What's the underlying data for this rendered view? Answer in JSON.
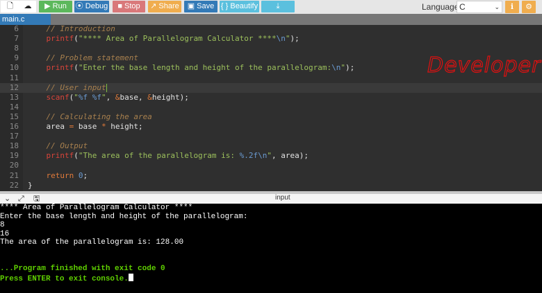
{
  "toolbar": {
    "new_file_icon": "file-icon",
    "upload_icon": "cloud-upload-icon",
    "run": {
      "icon": "▶",
      "label": "Run",
      "color": "#5cb85c"
    },
    "debug": {
      "icon": "⦿",
      "label": "Debug",
      "color": "#337ab7"
    },
    "stop": {
      "icon": "■",
      "label": "Stop",
      "color": "#d9787a"
    },
    "share": {
      "icon": "↗",
      "label": "Share",
      "color": "#f0ad4e"
    },
    "save": {
      "icon": "💾",
      "label": "Save",
      "color": "#337ab7"
    },
    "beautify": {
      "label": "{ } Beautify",
      "color": "#5bc0de"
    },
    "download": {
      "icon": "⤓",
      "color": "#5bc0de"
    },
    "language_label": "Language",
    "language_value": "C",
    "info_icon": "info-icon",
    "settings_icon": "gear-icon"
  },
  "tabs": [
    {
      "label": "main.c",
      "active": true
    }
  ],
  "watermark": "Developer",
  "editor": {
    "lines": [
      {
        "n": "6",
        "tokens": [
          [
            "c",
            "    // Introduction"
          ]
        ]
      },
      {
        "n": "7",
        "tokens": [
          [
            "p",
            "    "
          ],
          [
            "fn",
            "printf"
          ],
          [
            "p",
            "("
          ],
          [
            "s",
            "\"**** Area of Parallelogram Calculator ****"
          ],
          [
            "e",
            "\\n"
          ],
          [
            "s",
            "\""
          ],
          [
            "p",
            ");"
          ]
        ]
      },
      {
        "n": "8",
        "tokens": []
      },
      {
        "n": "9",
        "tokens": [
          [
            "c",
            "    // Problem statement"
          ]
        ]
      },
      {
        "n": "10",
        "tokens": [
          [
            "p",
            "    "
          ],
          [
            "fn",
            "printf"
          ],
          [
            "p",
            "("
          ],
          [
            "s",
            "\"Enter the base length and height of the parallelogram:"
          ],
          [
            "e",
            "\\n"
          ],
          [
            "s",
            "\""
          ],
          [
            "p",
            ");"
          ]
        ]
      },
      {
        "n": "11",
        "tokens": []
      },
      {
        "n": "12",
        "tokens": [
          [
            "c",
            "    // User input"
          ]
        ],
        "active": true
      },
      {
        "n": "13",
        "tokens": [
          [
            "p",
            "    "
          ],
          [
            "fn",
            "scanf"
          ],
          [
            "p",
            "("
          ],
          [
            "s",
            "\""
          ],
          [
            "e",
            "%f %f"
          ],
          [
            "s",
            "\""
          ],
          [
            "p",
            ", "
          ],
          [
            "op",
            "&"
          ],
          [
            "v",
            "base"
          ],
          [
            "p",
            ", "
          ],
          [
            "op",
            "&"
          ],
          [
            "v",
            "height"
          ],
          [
            "p",
            ");"
          ]
        ]
      },
      {
        "n": "14",
        "tokens": []
      },
      {
        "n": "15",
        "tokens": [
          [
            "c",
            "    // Calculating the area"
          ]
        ]
      },
      {
        "n": "16",
        "tokens": [
          [
            "p",
            "    "
          ],
          [
            "v",
            "area "
          ],
          [
            "op",
            "="
          ],
          [
            "v",
            " base "
          ],
          [
            "op",
            "*"
          ],
          [
            "v",
            " height;"
          ]
        ]
      },
      {
        "n": "17",
        "tokens": []
      },
      {
        "n": "18",
        "tokens": [
          [
            "c",
            "    // Output"
          ]
        ]
      },
      {
        "n": "19",
        "tokens": [
          [
            "p",
            "    "
          ],
          [
            "fn",
            "printf"
          ],
          [
            "p",
            "("
          ],
          [
            "s",
            "\"The area of the parallelogram is: "
          ],
          [
            "e",
            "%.2f\\n"
          ],
          [
            "s",
            "\""
          ],
          [
            "p",
            ", "
          ],
          [
            "v",
            "area"
          ],
          [
            "p",
            ");"
          ]
        ]
      },
      {
        "n": "20",
        "tokens": []
      },
      {
        "n": "21",
        "tokens": [
          [
            "p",
            "    "
          ],
          [
            "kw",
            "return "
          ],
          [
            "n",
            "0"
          ],
          [
            "p",
            ";"
          ]
        ]
      },
      {
        "n": "22",
        "tokens": [
          [
            "p",
            "}"
          ]
        ]
      }
    ]
  },
  "console_header": {
    "collapse_icon": "chevron-down-icon",
    "expand_icon": "expand-icon",
    "clear_icon": "clear-console-icon",
    "label": "input"
  },
  "console": {
    "lines": [
      {
        "text": "**** Area of Parallelogram Calculator ****",
        "style": "normal"
      },
      {
        "text": "Enter the base length and height of the parallelogram:",
        "style": "normal"
      },
      {
        "text": "8",
        "style": "normal"
      },
      {
        "text": "16",
        "style": "normal"
      },
      {
        "text": "The area of the parallelogram is: 128.00",
        "style": "normal"
      },
      {
        "text": "",
        "style": "normal"
      },
      {
        "text": "",
        "style": "normal"
      },
      {
        "text": "...Program finished with exit code 0",
        "style": "green"
      },
      {
        "text": "Press ENTER to exit console.",
        "style": "green",
        "cursor": true
      }
    ]
  }
}
